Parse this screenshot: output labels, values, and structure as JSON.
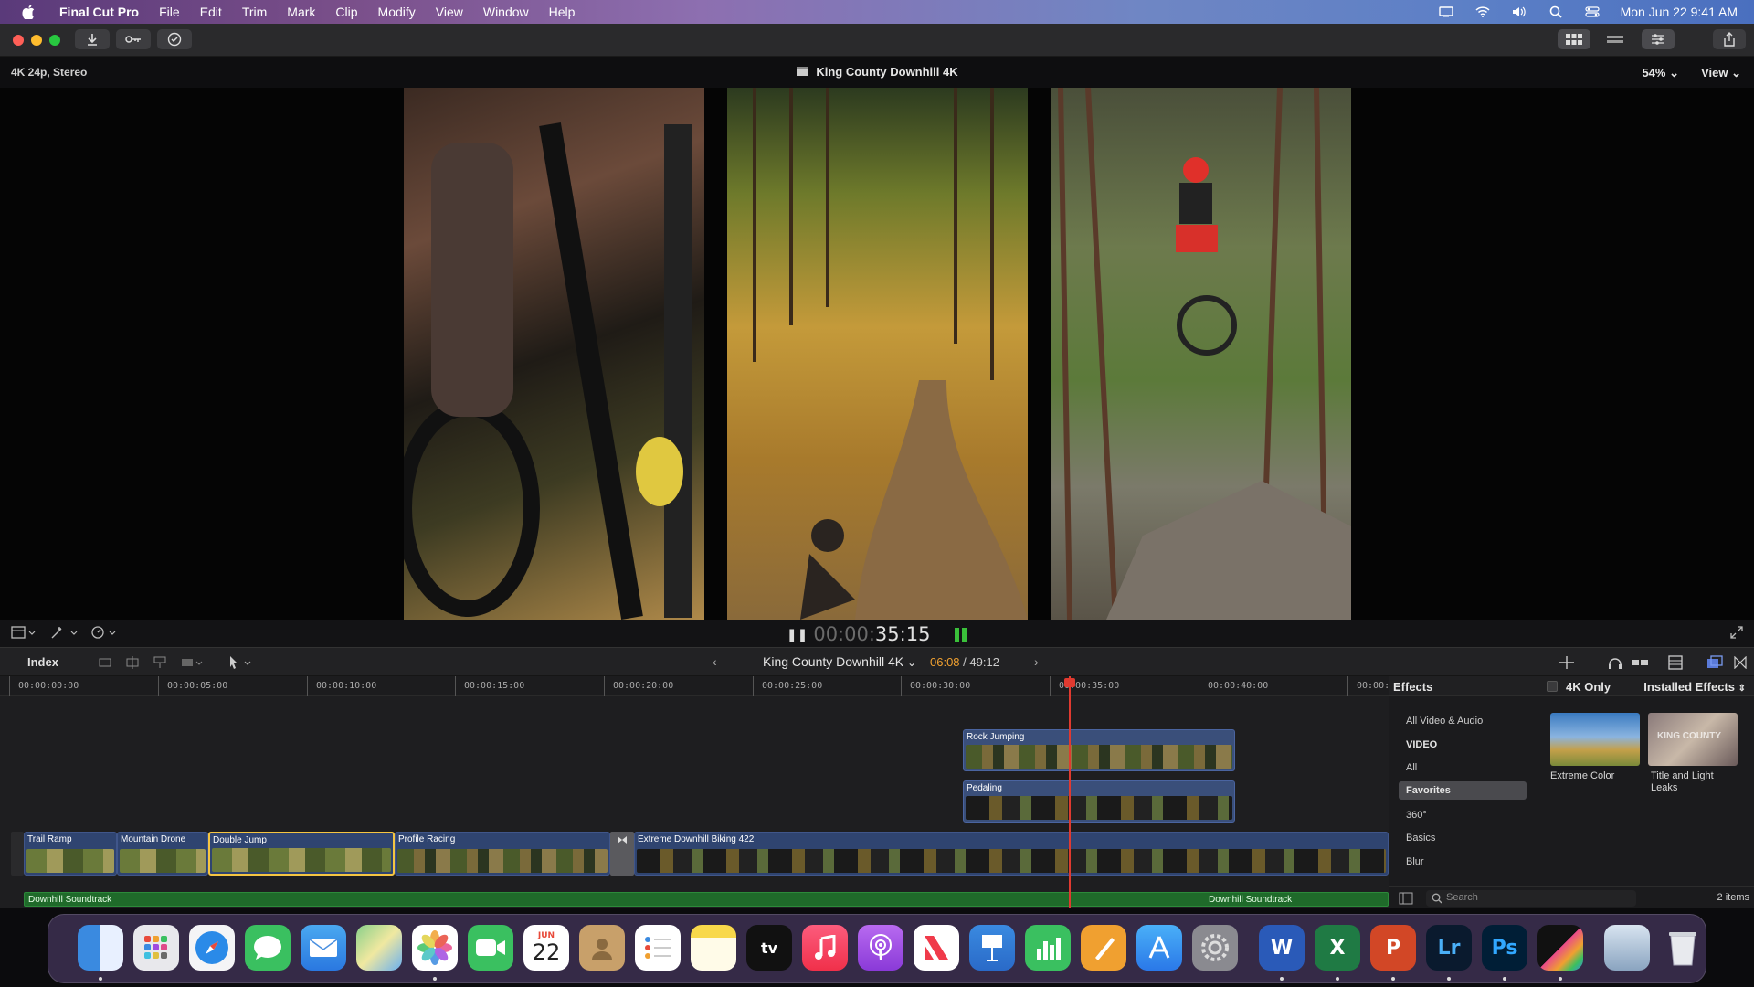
{
  "menubar": {
    "app_name": "Final Cut Pro",
    "items": [
      "File",
      "Edit",
      "Trim",
      "Mark",
      "Clip",
      "Modify",
      "View",
      "Window",
      "Help"
    ],
    "clock": "Mon Jun 22  9:41 AM"
  },
  "viewer": {
    "format": "4K 24p, Stereo",
    "project_title": "King County Downhill 4K",
    "zoom": "54%",
    "view_menu": "View",
    "timecode_dim": "00:00:",
    "timecode": "35:15"
  },
  "timeline_bar": {
    "index_label": "Index",
    "project": "King County Downhill 4K",
    "current": "06:08",
    "total": "/ 49:12"
  },
  "ruler": {
    "labels": [
      "00:00:00:00",
      "00:00:05:00",
      "00:00:10:00",
      "00:00:15:00",
      "00:00:20:00",
      "00:00:25:00",
      "00:00:30:00",
      "00:00:35:00",
      "00:00:40:00",
      "00:00:"
    ]
  },
  "clips": {
    "rock_jumping": "Rock Jumping",
    "pedaling": "Pedaling",
    "trail_ramp": "Trail Ramp",
    "mountain_drone": "Mountain Drone",
    "double_jump": "Double Jump",
    "profile_racing": "Profile Racing",
    "extreme_downhill": "Extreme Downhill Biking 422",
    "audio1": "Downhill Soundtrack",
    "audio2": "Downhill Soundtrack"
  },
  "effects": {
    "title": "Effects",
    "filter_4k": "4K Only",
    "installed": "Installed Effects",
    "categories": [
      "All Video & Audio",
      "VIDEO",
      "All",
      "Favorites",
      "360°",
      "Basics",
      "Blur"
    ],
    "selected_category": "Favorites",
    "items": [
      {
        "label": "Extreme Color"
      },
      {
        "label": "Title and Light Leaks",
        "line1": "Title and Light",
        "line2": "Leaks"
      }
    ],
    "search_placeholder": "Search",
    "count": "2 items"
  },
  "dock": {
    "apps": [
      "Finder",
      "Launchpad",
      "Safari",
      "Messages",
      "Mail",
      "Maps",
      "Photos",
      "FaceTime",
      "Calendar",
      "Contacts",
      "Reminders",
      "Notes",
      "TV",
      "Music",
      "Podcasts",
      "News",
      "Keynote",
      "Numbers",
      "Pages",
      "App Store",
      "System Preferences",
      "Word",
      "Excel",
      "PowerPoint",
      "Lightroom",
      "Photoshop",
      "Final Cut Pro",
      "Preview",
      "Trash"
    ],
    "calendar_month": "JUN",
    "calendar_day": "22",
    "word_letter": "W",
    "excel_letter": "X",
    "ppt_letter": "P",
    "lr_letter": "Lr",
    "ps_letter": "Ps"
  },
  "colors": {
    "accent_playhead": "#e03a30",
    "selected_clip": "#f5c542",
    "audio_clip": "#1f6a2a",
    "video_clip": "#2f4470"
  }
}
